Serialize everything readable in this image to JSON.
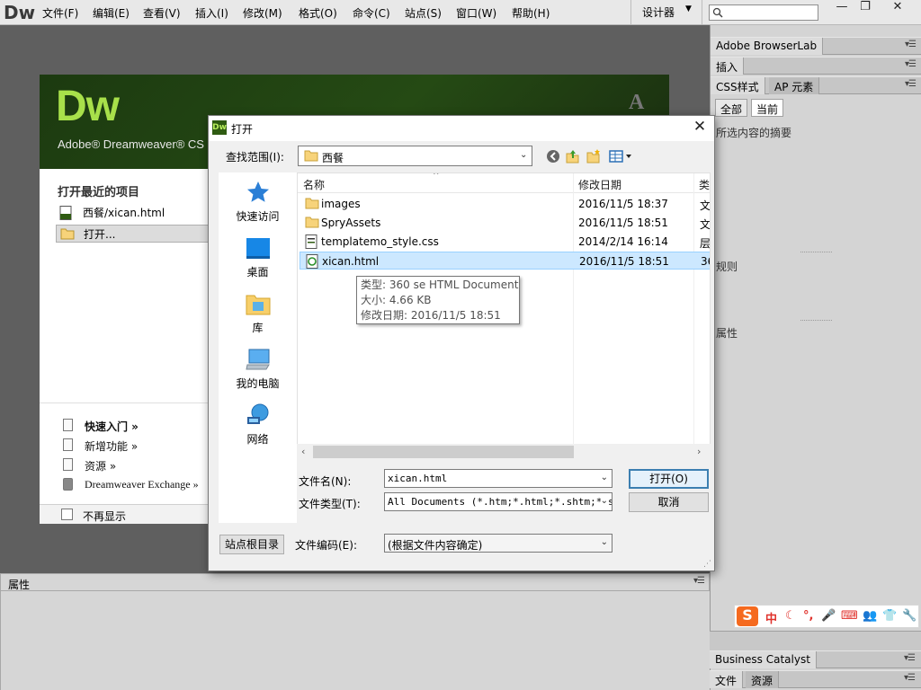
{
  "app": {
    "logo": "Dw",
    "menu": [
      "文件(F)",
      "编辑(E)",
      "查看(V)",
      "插入(I)",
      "修改(M)",
      "格式(O)",
      "命令(C)",
      "站点(S)",
      "窗口(W)",
      "帮助(H)"
    ],
    "workspace_switcher": "设计器",
    "window_controls": {
      "minimize": "—",
      "maximize": "❐",
      "close": "✕"
    }
  },
  "welcome": {
    "logo": "Dw",
    "product": "Adobe® Dreamweaver® CS",
    "adobe_mark": "A",
    "recent_heading": "打开最近的项目",
    "recent_items": [
      "西餐/xican.html",
      "打开..."
    ],
    "links": [
      "快速入门 »",
      "新增功能 »",
      "资源 »",
      "Dreamweaver Exchange »"
    ],
    "dont_show": "不再显示"
  },
  "properties_panel": {
    "title": "属性"
  },
  "right_dock": {
    "browserlab": "Adobe BrowserLab",
    "insert": "插入",
    "tabs": [
      "CSS样式",
      "AP 元素"
    ],
    "css_buttons": [
      "全部",
      "当前"
    ],
    "selection_summary": "所选内容的摘要",
    "rules_label": "规则",
    "properties_label": "属性",
    "business_catalyst": "Business Catalyst",
    "bottom_tabs": [
      "文件",
      "资源"
    ],
    "ime_logo": "S",
    "ime_icons": [
      "中",
      "☾",
      "°,",
      "🎤",
      "⌨",
      "👥",
      "👕",
      "🔧"
    ]
  },
  "dialog": {
    "title": "打开",
    "icon": "Dw",
    "look_in_label": "查找范围(I):",
    "look_in_value": "西餐",
    "places": [
      "快速访问",
      "桌面",
      "库",
      "我的电脑",
      "网络"
    ],
    "columns": [
      "名称",
      "修改日期",
      "类"
    ],
    "files": [
      {
        "name": "images",
        "date": "2016/11/5 18:37",
        "type": "文",
        "icon": "folder-icon"
      },
      {
        "name": "SpryAssets",
        "date": "2016/11/5 18:51",
        "type": "文",
        "icon": "folder-icon"
      },
      {
        "name": "templatemo_style.css",
        "date": "2014/2/14 16:14",
        "type": "层",
        "icon": "css-file-icon"
      },
      {
        "name": "xican.html",
        "date": "2016/11/5 18:51",
        "type": "36",
        "icon": "html-file-icon"
      }
    ],
    "selected_file": "xican.html",
    "tooltip": [
      "类型: 360 se HTML Document",
      "大小: 4.66 KB",
      "修改日期: 2016/11/5 18:51"
    ],
    "filename_label": "文件名(N):",
    "filename_value": "xican.html",
    "filetype_label": "文件类型(T):",
    "filetype_value": "All Documents (*.htm;*.html;*.shtm;*.sl",
    "open_button": "打开(O)",
    "cancel_button": "取消",
    "site_root_button": "站点根目录",
    "encoding_label": "文件编码(E):",
    "encoding_value": "(根据文件内容确定)"
  },
  "colors": {
    "selection": "#cce8ff",
    "dw_green": "#a8e04a",
    "banner_bg": "#254a14"
  }
}
